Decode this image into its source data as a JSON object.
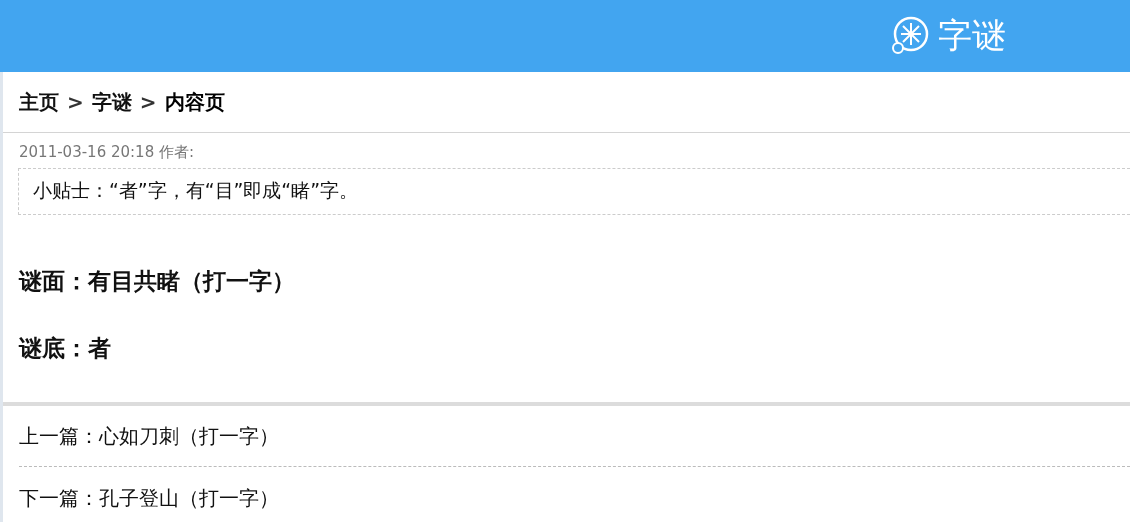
{
  "header": {
    "title": "字谜"
  },
  "breadcrumb": [
    {
      "text": "主页",
      "kind": "link"
    },
    {
      "text": ">",
      "kind": "sep"
    },
    {
      "text": "字谜",
      "kind": "link"
    },
    {
      "text": ">",
      "kind": "sep"
    },
    {
      "text": "内容页",
      "kind": "current"
    }
  ],
  "meta": "2011-03-16 20:18 作者:",
  "tip": "小贴士：“者”字，有“目”即成“睹”字。",
  "riddle": [
    "谜面：有目共睹（打一字）",
    "谜底：者"
  ],
  "nav": [
    {
      "label": "上一篇：",
      "title": "心如刀刺（打一字）"
    },
    {
      "label": "下一篇：",
      "title": "孔子登山（打一字）"
    }
  ]
}
